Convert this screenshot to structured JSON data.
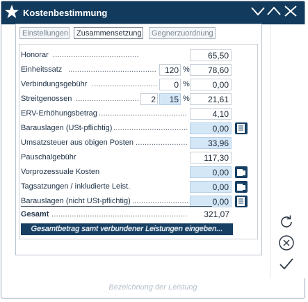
{
  "window": {
    "title": "Kostenbestimmung",
    "footer_label": "Bezeichnung der Leistung"
  },
  "tabs": [
    {
      "label": "Einstellungen",
      "active": false
    },
    {
      "label": "Zusammensetzung",
      "active": true
    },
    {
      "label": "Gegnerzuordnung",
      "active": false
    }
  ],
  "rows": {
    "honorar": {
      "label": "Honorar",
      "value": "65,50"
    },
    "einheitssatz": {
      "label": "Einheitssatz",
      "percent": "120",
      "percent_sign": "%",
      "value": "78,60"
    },
    "verbindungsgebuehr": {
      "label": "Verbindungsgebühr",
      "percent": "0",
      "percent_sign": "%",
      "value": "0,00"
    },
    "streitgenossen": {
      "label": "Streitgenossen",
      "count": "2",
      "percent": "15",
      "percent_sign": "%",
      "value": "21,61"
    },
    "erv": {
      "label": "ERV-Erhöhungsbetrag",
      "value": "4,10"
    },
    "barauslagen_ust": {
      "label": "Barauslagen (USt-pflichtig)",
      "value": "0,00"
    },
    "umsatzsteuer": {
      "label": "Umsatzsteuer aus obigen Posten",
      "value": "33,96"
    },
    "pauschalgebuehr": {
      "label": "Pauschalgebühr",
      "value": "117,30"
    },
    "vorprozessuale": {
      "label": "Vorprozessuale Kosten",
      "value": "0,00"
    },
    "tagsatzungen": {
      "label": "Tagsatzungen / inkludierte Leist.",
      "value": "0,00"
    },
    "barauslagen_nicht": {
      "label": "Barauslagen (nicht USt-pflichtig)",
      "value": "0,00"
    },
    "gesamt": {
      "label": "Gesamt",
      "value": "321,07"
    }
  },
  "actions": {
    "gesamtbetrag_button": "Gesamtbetrag samt verbundener Leistungen eingeben..."
  },
  "colors": {
    "titlebar": "#123a5c",
    "accent_field": "#d4e7f7",
    "button": "#163f63"
  }
}
